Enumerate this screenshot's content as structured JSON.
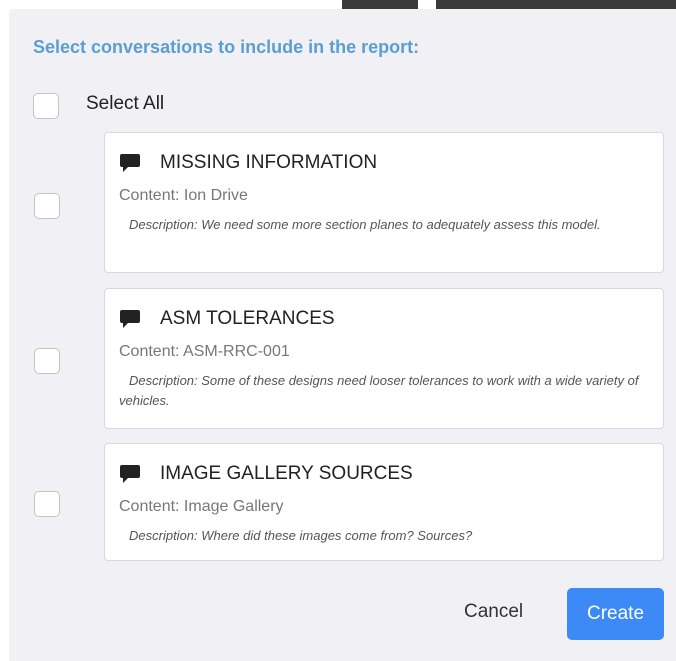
{
  "dialog": {
    "heading": "Select conversations to include in the report:",
    "select_all_label": "Select All",
    "conversations": [
      {
        "title": "MISSING INFORMATION",
        "content": "Content: Ion Drive",
        "description": "Description: We need some more section planes to adequately assess this model.",
        "icon": "comment-icon"
      },
      {
        "title": "ASM TOLERANCES",
        "content": "Content: ASM-RRC-001",
        "description": "Description: Some of these designs need looser tolerances to work with a wide variety of vehicles.",
        "icon": "comment-icon"
      },
      {
        "title": "IMAGE GALLERY SOURCES",
        "content": "Content: Image Gallery",
        "description": "Description: Where did these images come from? Sources?",
        "icon": "comment-icon"
      }
    ],
    "cancel_label": "Cancel",
    "create_label": "Create"
  },
  "colors": {
    "heading": "#5a9fd4",
    "primary_button": "#3d8af7",
    "dialog_background": "#f1f0f5"
  }
}
